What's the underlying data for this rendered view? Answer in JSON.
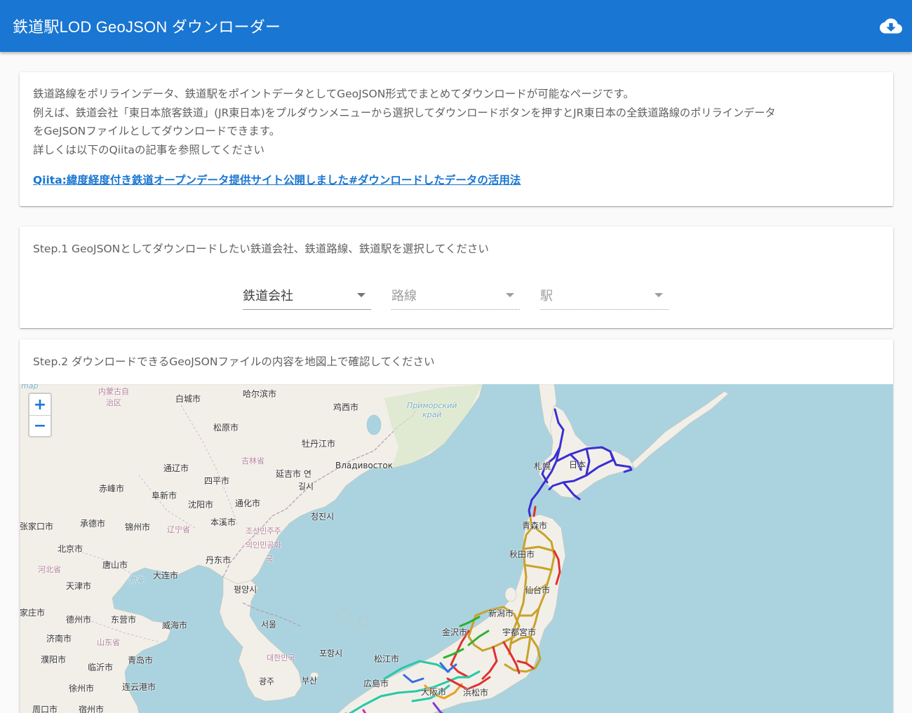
{
  "app": {
    "title": "鉄道駅LOD GeoJSON ダウンローダー",
    "download_icon": "cloud-download-icon",
    "colors": {
      "primary": "#1976d2",
      "map_water": "#aad3df",
      "map_land": "#f2efe9"
    }
  },
  "intro": {
    "lines": [
      "鉄道路線をポリラインデータ、鉄道駅をポイントデータとしてGeoJSON形式でまとめてダウンロードが可能なページです。",
      "例えば、鉄道会社「東日本旅客鉄道」(JR東日本)をプルダウンメニューから選択してダウンロードボタンを押すとJR東日本の全鉄道路線のポリラインデータ",
      "をGeJSONファイルとしてダウンロードできます。",
      "詳しくは以下のQiitaの記事を参照してください"
    ],
    "link_text": "Qiita:緯度経度付き鉄道オープンデータ提供サイト公開しました#ダウンロードしたデータの活用法"
  },
  "step1": {
    "title": "Step.1 GeoJSONとしてダウンロードしたい鉄道会社、鉄道路線、鉄道駅を選択してください",
    "selects": {
      "company": "鉄道会社",
      "line": "路線",
      "station": "駅"
    }
  },
  "step2": {
    "title": "Step.2 ダウンロードできるGeoJSONファイルの内容を地図上で確認してください",
    "zoom_in": "+",
    "zoom_out": "−",
    "labels": {
      "map_attr": "map",
      "neimenggu": "内蒙古自\n治区",
      "baicheng": "白城市",
      "harbin": "哈尔滨市",
      "jixi": "鸡西市",
      "primorsky": "Приморский\nкрай",
      "songyuan": "松原市",
      "mudanjiang": "牡丹江市",
      "jilin": "吉林省",
      "tongliao": "通辽市",
      "siping": "四平市",
      "yanji": "延吉市 연",
      "gilsi": "길시",
      "vladivostok": "Владивосток",
      "chifeng": "赤峰市",
      "fuxin": "阜新市",
      "shenyang": "沈阳市",
      "tonghua": "通化市",
      "chongjin": "청진시",
      "zhangjiakou": "张家口市",
      "chengde": "承德市",
      "jinzhou": "锦州市",
      "liaoning": "辽宁省",
      "benxi": "本溪市",
      "dprk1": "조선민주주",
      "dprk2": "의인민공화",
      "dprk3": "국",
      "beijing": "北京市",
      "tangshan": "唐山市",
      "hebei": "河北省",
      "bohai": "渤海",
      "dalian": "大连市",
      "dandong": "丹东市",
      "tianjin": "天津市",
      "pyongyang": "평양시",
      "shijiazhuang": "家庄市",
      "dezhou": "德州市",
      "dongying": "东营市",
      "weihai": "威海市",
      "seoul": "서울",
      "jinan": "济南市",
      "shandong": "山东省",
      "puyang": "濮阳市",
      "qingdao": "青岛市",
      "linyi": "临沂市",
      "korea": "대한민국",
      "pohang": "포항시",
      "gwangju": "광주",
      "busan": "부산",
      "xuzhou": "徐州市",
      "lianyungang": "连云港市",
      "zhoukou": "周口市",
      "suzhou": "宿州市",
      "sapporo": "札幌",
      "japan": "日本",
      "aomori": "青森市",
      "akita": "秋田市",
      "sendai": "仙台市",
      "niigata": "新潟市",
      "kanazawa": "金沢市",
      "utsunomiya": "宇都宮市",
      "matsue": "松江市",
      "hiroshima": "広島市",
      "osaka": "大阪市",
      "hamamatsu": "浜松市"
    }
  }
}
